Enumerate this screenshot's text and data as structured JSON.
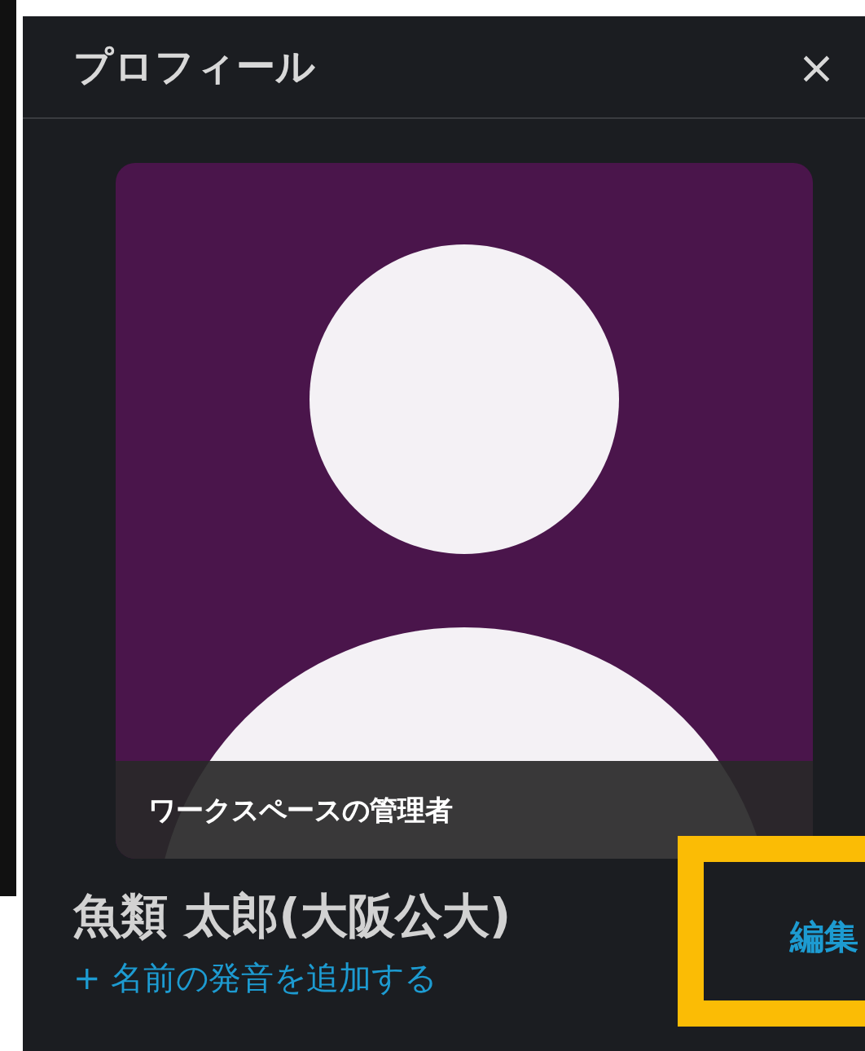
{
  "panel": {
    "title": "プロフィール",
    "close": "×"
  },
  "avatar": {
    "badge": "ワークスペースの管理者"
  },
  "profile": {
    "name": "魚類 太郎(大阪公大)",
    "pronunciation_link": "+ 名前の発音を追加する",
    "edit": "編集",
    "edit_highlighted": true
  }
}
